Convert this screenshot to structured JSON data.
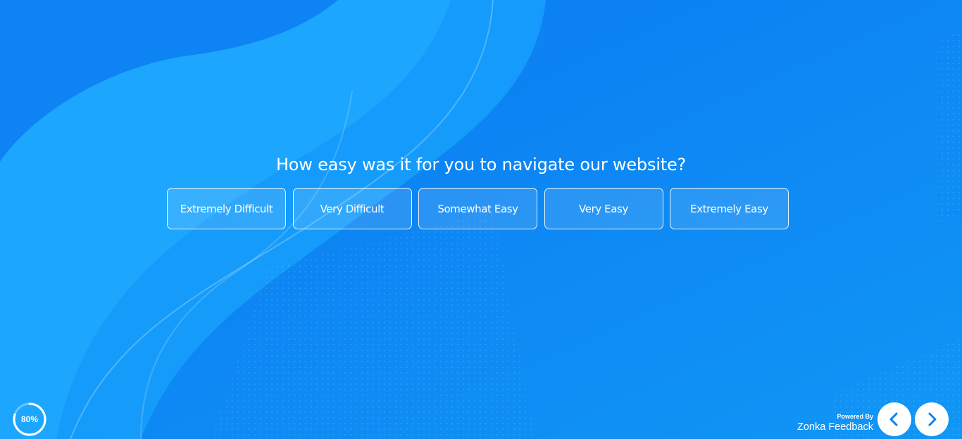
{
  "survey": {
    "question": "How easy was it for you to navigate our website?",
    "options": [
      {
        "label": "Extremely Difficult"
      },
      {
        "label": "Very Difficult"
      },
      {
        "label": "Somewhat Easy"
      },
      {
        "label": "Very Easy"
      },
      {
        "label": "Extremely Easy"
      }
    ]
  },
  "progress": {
    "label": "80%",
    "value": 0.8
  },
  "footer": {
    "powered_by": "Powered By",
    "brand": "Zonka Feedback"
  },
  "navigation": {
    "prev_icon": "chevron-left-icon",
    "next_icon": "chevron-right-icon"
  },
  "colors": {
    "background": "#0b84ee",
    "accent": "#ffffff",
    "wave_light": "#1ea7ff"
  }
}
